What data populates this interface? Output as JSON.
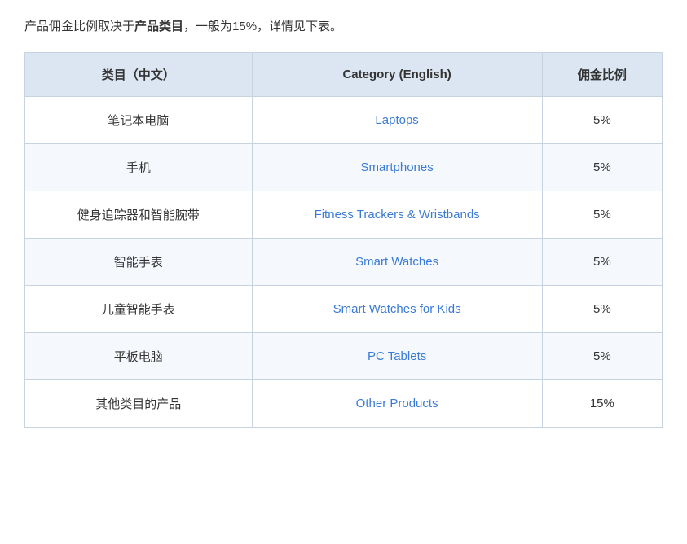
{
  "intro": {
    "text_before": "产品佣金比例取决于",
    "highlighted": "产品类目",
    "text_after": "，一般为15%，详情见下表。"
  },
  "table": {
    "headers": [
      {
        "key": "zh",
        "label": "类目（中文）"
      },
      {
        "key": "en",
        "label": "Category (English)"
      },
      {
        "key": "rate",
        "label": "佣金比例"
      }
    ],
    "rows": [
      {
        "zh": "笔记本电脑",
        "en": "Laptops",
        "rate": "5%"
      },
      {
        "zh": "手机",
        "en": "Smartphones",
        "rate": "5%"
      },
      {
        "zh": "健身追踪器和智能腕带",
        "en": "Fitness Trackers & Wristbands",
        "rate": "5%"
      },
      {
        "zh": "智能手表",
        "en": "Smart Watches",
        "rate": "5%"
      },
      {
        "zh": "儿童智能手表",
        "en": "Smart Watches for Kids",
        "rate": "5%"
      },
      {
        "zh": "平板电脑",
        "en": "PC Tablets",
        "rate": "5%"
      },
      {
        "zh": "其他类目的产品",
        "en": "Other Products",
        "rate": "15%"
      }
    ]
  }
}
